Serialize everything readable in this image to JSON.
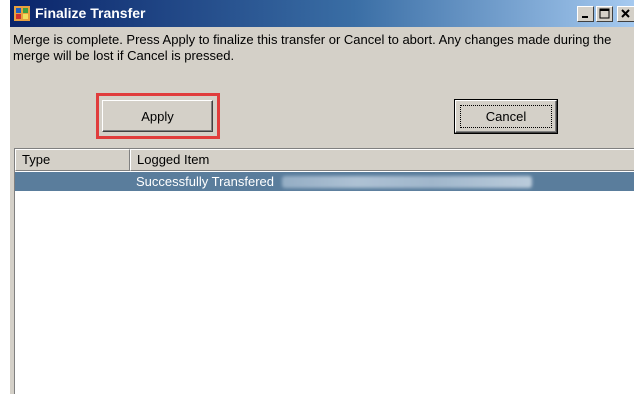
{
  "window": {
    "title": "Finalize Transfer"
  },
  "titlebar_buttons": {
    "minimize_icon": "minimize-icon",
    "maximize_icon": "maximize-icon",
    "close_icon": "close-icon"
  },
  "message": "Merge is complete.  Press Apply to finalize this transfer or Cancel to abort.  Any changes made during the merge will be lost if Cancel is pressed.",
  "buttons": {
    "apply_label": "Apply",
    "cancel_label": "Cancel"
  },
  "log_list": {
    "columns": [
      "Type",
      "Logged Item"
    ],
    "rows": [
      {
        "type": "",
        "logged_item": "Successfully  Transfered"
      }
    ]
  },
  "colors": {
    "title_gradient_start": "#0a246a",
    "title_gradient_end": "#a6caf0",
    "selected_row": "#5a7d9c",
    "highlight_box": "#e03c3c",
    "face": "#d4d0c8"
  }
}
